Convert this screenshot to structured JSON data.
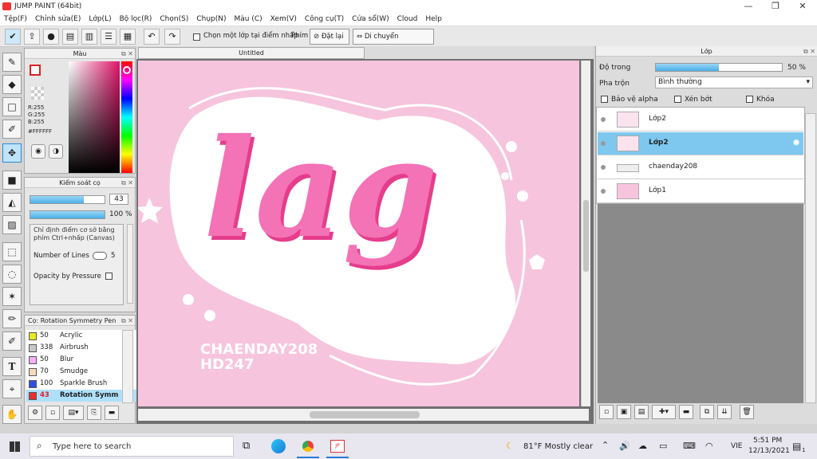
{
  "window": {
    "title": "JUMP PAINT (64bit)",
    "minimize": "—",
    "maximize": "❐",
    "close": "✕"
  },
  "menu": [
    "Tệp(F)",
    "Chỉnh sửa(E)",
    "Lớp(L)",
    "Bộ lọc(R)",
    "Chọn(S)",
    "Chụp(N)",
    "Màu (C)",
    "Xem(V)",
    "Công cụ(T)",
    "Cửa sổ(W)",
    "Cloud",
    "Help"
  ],
  "toolbar": {
    "snap_label": "Chọn một lớp tại điểm nhấp",
    "key_label": "Phím",
    "reset_label": "Đặt lại",
    "move_label": "Di chuyển ngang/dọc"
  },
  "color_panel": {
    "title": "Màu",
    "r": "R:255",
    "g": "G:255",
    "b": "B:255",
    "hex": "#FFFFFF"
  },
  "brush_control": {
    "title": "Kiểm soát cọ",
    "size": "43",
    "opacity": "100 %",
    "size_level": 0.72,
    "opacity_level": 1.0,
    "hint": "Chỉ định điểm cơ sở bằng phím Ctrl+nhấp (Canvas)",
    "lines_label": "Number of Lines",
    "lines_value": "5",
    "pressure_label": "Opacity by Pressure"
  },
  "brush_list": {
    "title": "Cọ: Rotation Symmetry Pen",
    "items": [
      {
        "size": "50",
        "name": "Acrylic",
        "color": "#e8e81e"
      },
      {
        "size": "338",
        "name": "Airbrush",
        "color": "#c8c8c8"
      },
      {
        "size": "50",
        "name": "Blur",
        "color": "#f4b0f4"
      },
      {
        "size": "70",
        "name": "Smudge",
        "color": "#f4dcc0"
      },
      {
        "size": "100",
        "name": "Sparkle Brush",
        "color": "#3050e0"
      },
      {
        "size": "43",
        "name": "Rotation Symm",
        "color": "#e83030"
      }
    ]
  },
  "canvas": {
    "tab": "Untitled",
    "art_text": "lag",
    "watermark_1": "CHAENDAY208",
    "watermark_2": "HD247"
  },
  "layer_panel": {
    "title": "Lớp",
    "opacity_label": "Độ trong",
    "opacity_value": "50 %",
    "opacity_level": 0.5,
    "blend_label": "Pha trộn",
    "blend_value": "Bình thường",
    "protect_alpha": "Bảo vệ alpha",
    "clip": "Xén bớt",
    "lock": "Khóa",
    "layers": [
      {
        "name": "Lớp2",
        "selected": false
      },
      {
        "name": "Lớp2",
        "selected": true
      },
      {
        "name": "chaenday208",
        "selected": false
      },
      {
        "name": "Lớp1",
        "selected": false
      }
    ]
  },
  "taskbar": {
    "search_placeholder": "Type here to search",
    "weather": "81°F  Mostly clear",
    "lang": "VIE",
    "time": "5:51 PM",
    "date": "12/13/2021",
    "notif_count": "1"
  },
  "colors": {
    "accent": "#4ab0e8",
    "selected_layer": "#7ec8f0",
    "canvas_bg": "#f7c4dd",
    "letter_pink": "#f0449a"
  }
}
